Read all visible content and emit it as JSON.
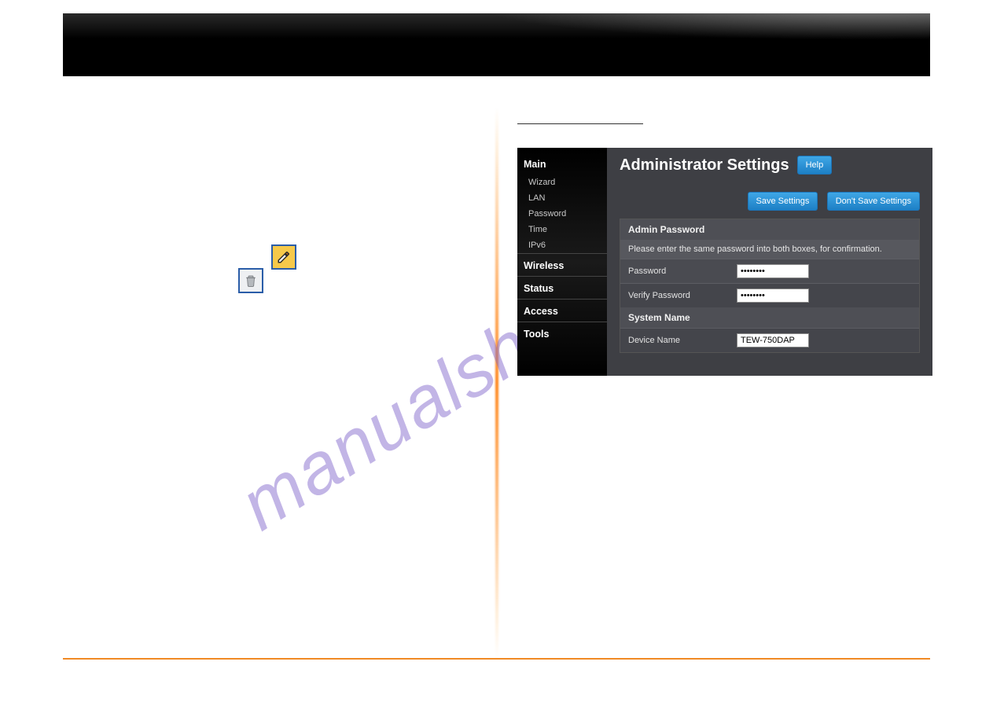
{
  "watermark_text": "manualshive.com",
  "nav_path": "",
  "admin_panel": {
    "title": "Administrator Settings",
    "help_button": "Help",
    "save_button": "Save Settings",
    "dont_save_button": "Don't Save Settings",
    "sidebar": {
      "sections": [
        {
          "label": "Main",
          "items": [
            "Wizard",
            "LAN",
            "Password",
            "Time",
            "IPv6"
          ]
        },
        {
          "label": "Wireless",
          "items": []
        },
        {
          "label": "Status",
          "items": []
        },
        {
          "label": "Access",
          "items": []
        },
        {
          "label": "Tools",
          "items": []
        }
      ]
    },
    "password_block": {
      "header": "Admin Password",
      "note": "Please enter the same password into both boxes, for confirmation.",
      "rows": [
        {
          "label": "Password",
          "value": "••••••••"
        },
        {
          "label": "Verify Password",
          "value": "••••••••"
        }
      ]
    },
    "system_block": {
      "header": "System Name",
      "rows": [
        {
          "label": "Device Name",
          "value": "TEW-750DAP"
        }
      ]
    }
  }
}
